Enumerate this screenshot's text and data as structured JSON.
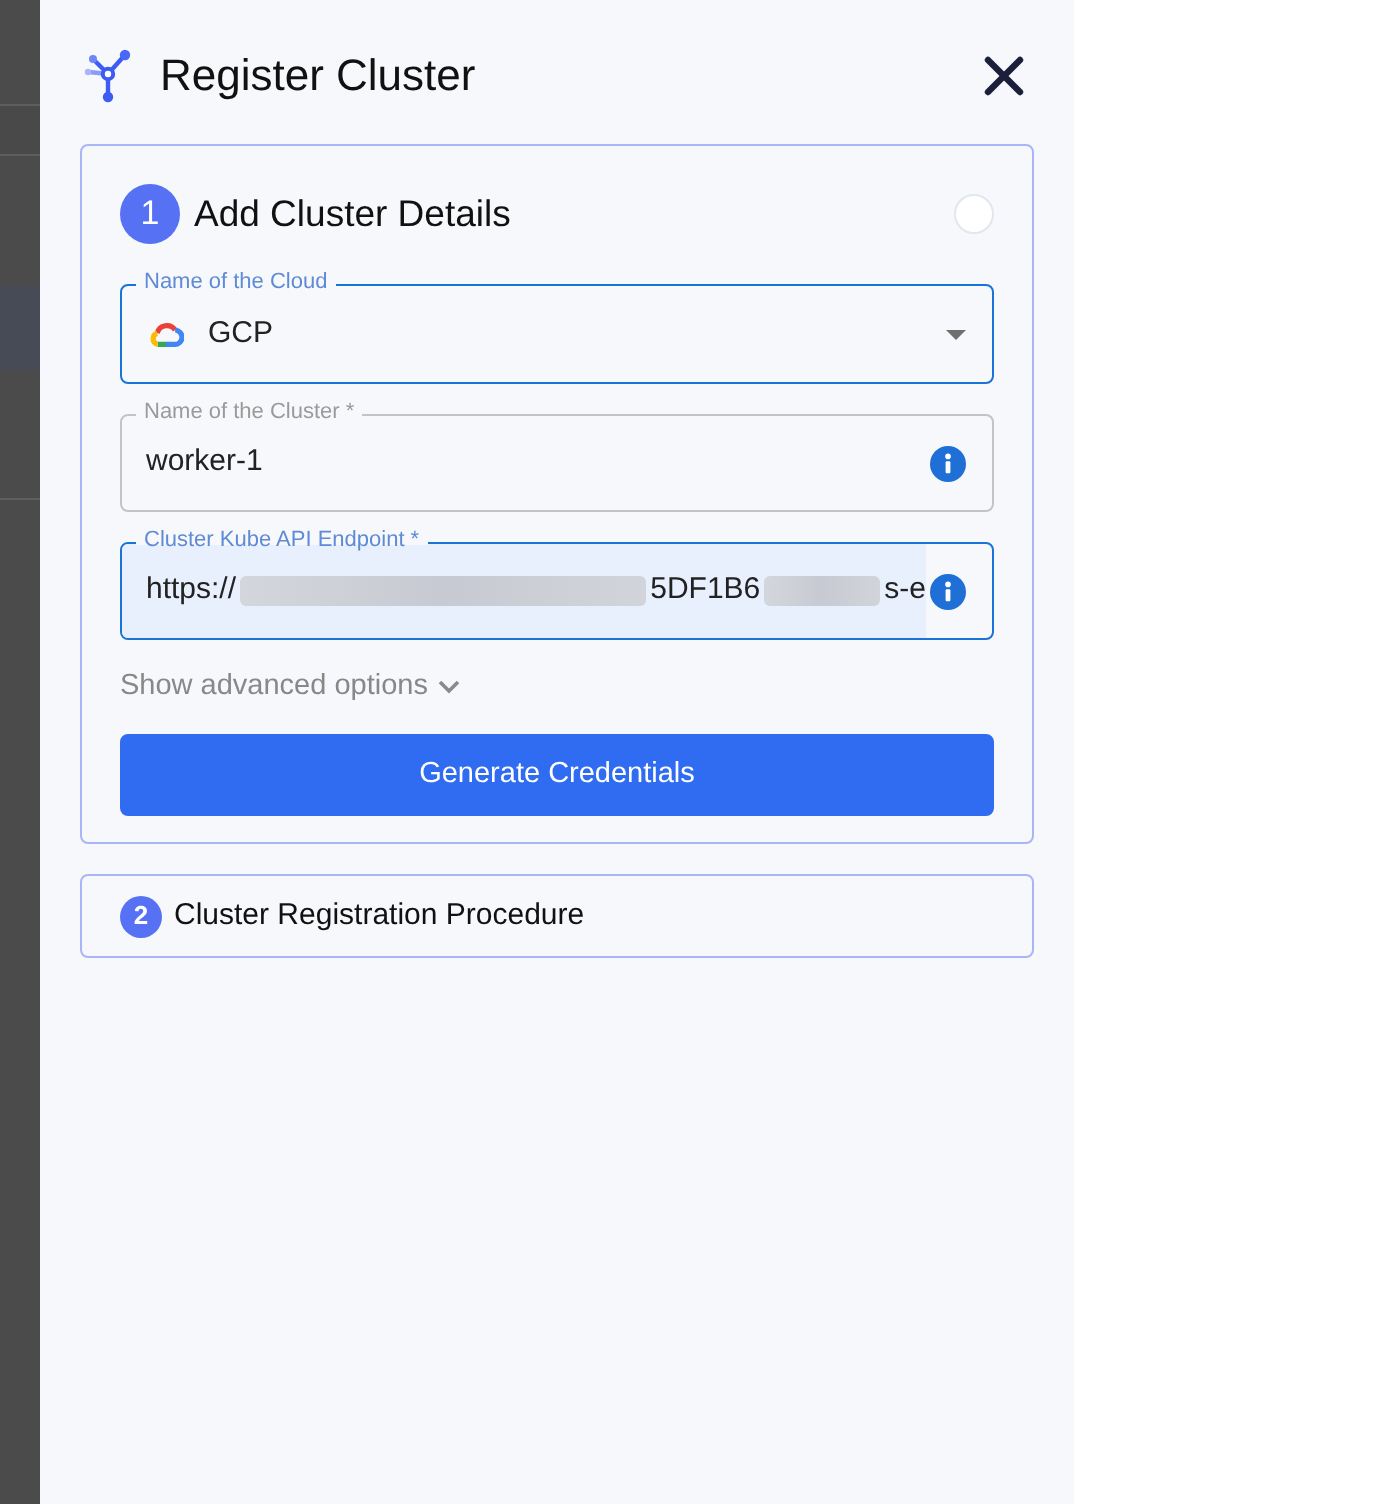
{
  "window": {
    "title": "Register Cluster"
  },
  "steps": [
    {
      "number": "1",
      "title": "Add Cluster Details",
      "expanded": true,
      "fields": [
        {
          "kind": "select",
          "label": "Name of the Cloud",
          "value": "GCP",
          "focused": true,
          "autofilled": false,
          "info": false
        },
        {
          "kind": "text",
          "label": "Name of the Cluster *",
          "value": "worker-1",
          "focused": false,
          "autofilled": false,
          "info": true
        },
        {
          "kind": "text",
          "label": "Cluster Kube API Endpoint *",
          "value_parts": [
            {
              "kind": "text",
              "text": "https://"
            },
            {
              "kind": "redacted"
            },
            {
              "kind": "text",
              "text": "5DF1B6"
            },
            {
              "kind": "redacted"
            },
            {
              "kind": "text",
              "text": "s-e"
            }
          ],
          "focused": true,
          "autofilled": true,
          "info": true
        }
      ],
      "advanced_options": {
        "label": "Show advanced options",
        "expanded": false
      },
      "button": "Generate Credentials"
    },
    {
      "number": "2",
      "title": "Cluster Registration Procedure",
      "expanded": false
    }
  ]
}
